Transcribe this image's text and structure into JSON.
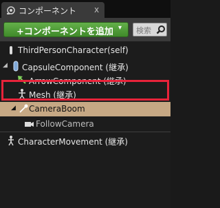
{
  "tab": {
    "title": "コンポーネント",
    "close": "x",
    "icon": "components-panel-icon"
  },
  "toolbar": {
    "add_label": "+コンポーネントを追加",
    "add_plus": "+",
    "add_arrow": "▾",
    "search_placeholder": "検索"
  },
  "tree": [
    {
      "label": "ThirdPersonCharacter(self)",
      "icon": "character-icon"
    },
    {
      "label": "CapsuleComponent (継承)",
      "icon": "capsule-icon",
      "expanded": true
    },
    {
      "label": "ArrowComponent (継承)",
      "icon": "arrow-icon"
    },
    {
      "label": "Mesh (継承)",
      "icon": "mesh-icon"
    },
    {
      "label": "CameraBoom",
      "icon": "camera-boom-icon",
      "expanded": true,
      "selected": true
    },
    {
      "label": "FollowCamera",
      "icon": "camera-icon"
    },
    {
      "label": "CharacterMovement (継承)",
      "icon": "movement-icon"
    }
  ],
  "colors": {
    "add_button": "#4f9b36",
    "selected_row": "#c6a884",
    "highlight": "#e8233a"
  }
}
